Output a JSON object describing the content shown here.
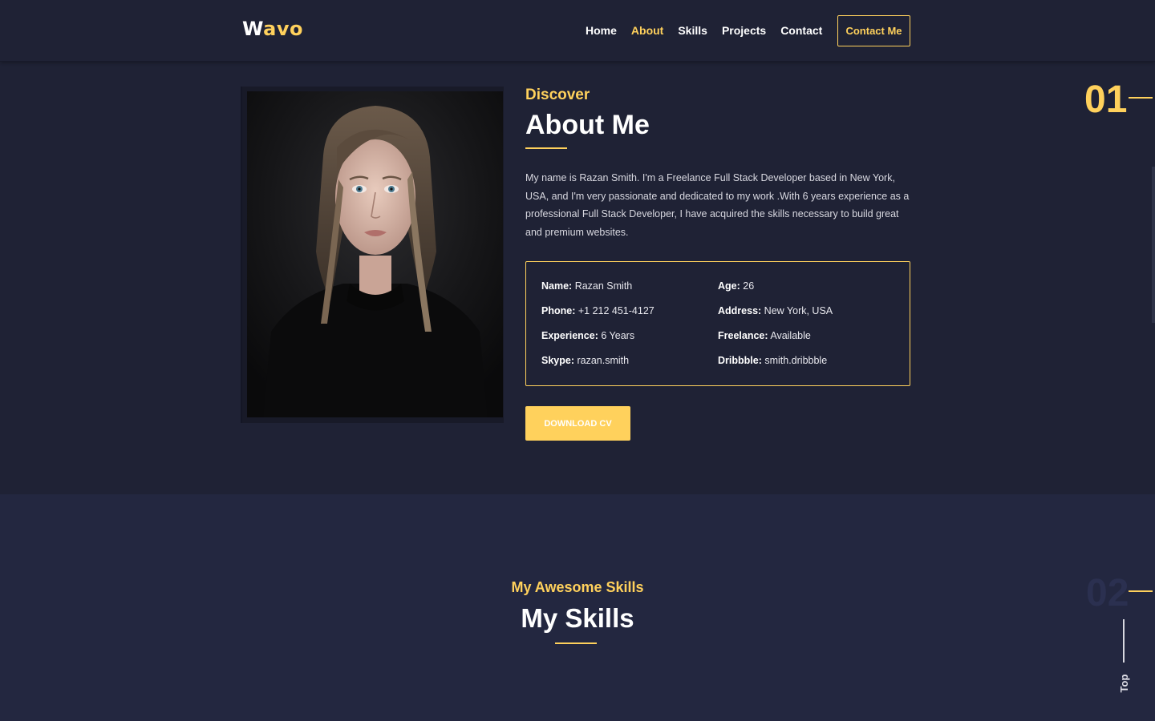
{
  "header": {
    "logo_first": "W",
    "logo_rest": "avo",
    "nav": [
      {
        "label": "Home",
        "active": false
      },
      {
        "label": "About",
        "active": true
      },
      {
        "label": "Skills",
        "active": false
      },
      {
        "label": "Projects",
        "active": false
      },
      {
        "label": "Contact",
        "active": false
      }
    ],
    "contact_button": "Contact Me"
  },
  "about": {
    "subtitle": "Discover",
    "title": "About Me",
    "bio": "My name is Razan Smith. I'm a Freelance Full Stack Developer based in New York, USA, and I'm very passionate and dedicated to my work .With 6 years experience as a professional Full Stack Developer, I have acquired the skills necessary to build great and premium websites.",
    "info": {
      "name": {
        "label": "Name:",
        "value": "Razan Smith"
      },
      "age": {
        "label": "Age:",
        "value": "26"
      },
      "phone": {
        "label": "Phone:",
        "value": "+1 212 451-4127"
      },
      "address": {
        "label": "Address:",
        "value": "New York, USA"
      },
      "experience": {
        "label": "Experience:",
        "value": "6 Years"
      },
      "freelance": {
        "label": "Freelance:",
        "value": "Available"
      },
      "skype": {
        "label": "Skype:",
        "value": "razan.smith"
      },
      "dribbble": {
        "label": "Dribbble:",
        "value": "smith.dribbble"
      }
    },
    "download_button": "DOWNLOAD CV",
    "section_number": "01"
  },
  "skills": {
    "subtitle": "My Awesome Skills",
    "title": "My Skills",
    "section_number": "02"
  },
  "top_button": "Top",
  "colors": {
    "background": "#1f2235",
    "skills_background": "#232740",
    "accent": "#ffd15c"
  }
}
